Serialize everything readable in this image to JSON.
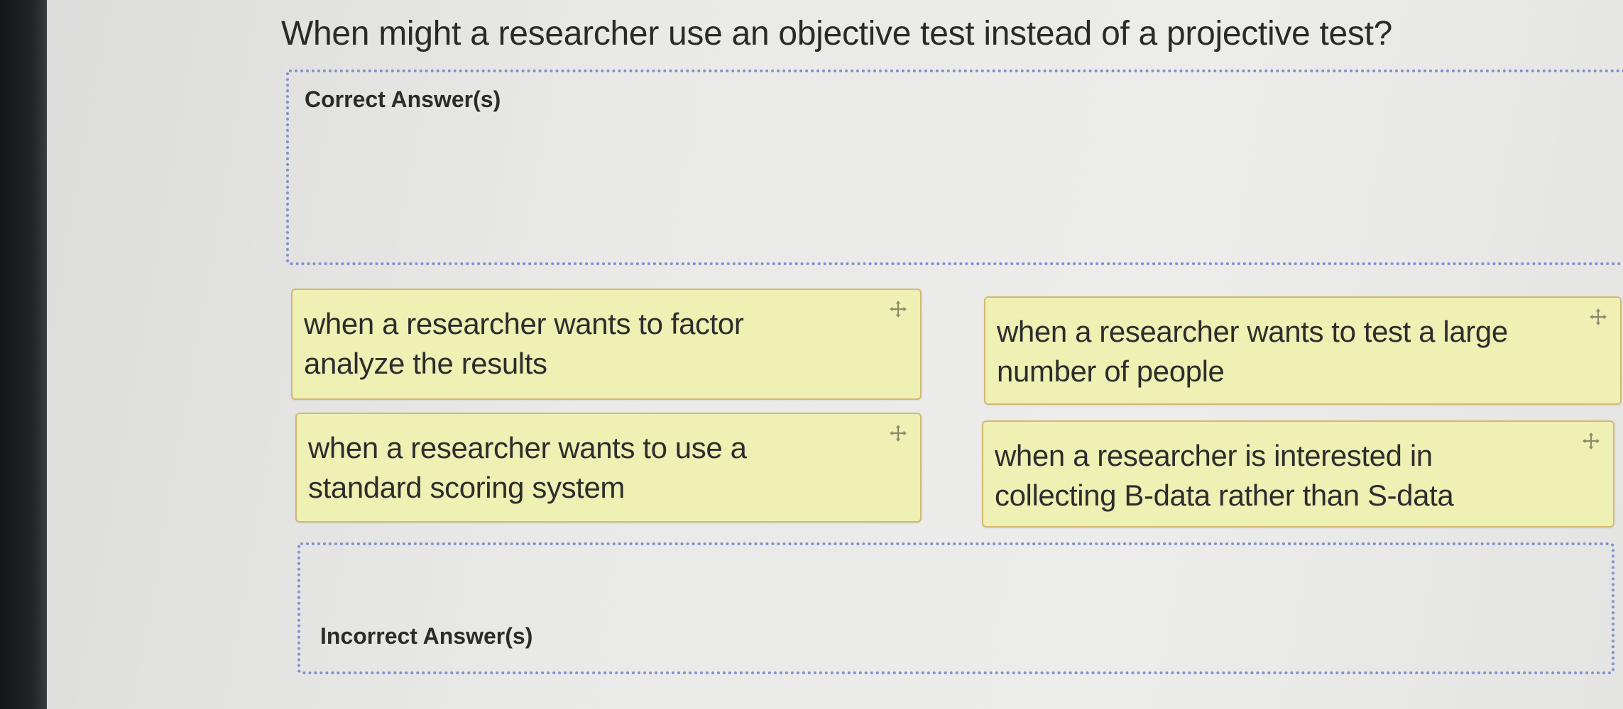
{
  "question": "When might a researcher use an objective test instead of a projective test?",
  "zones": {
    "correct_label": "Correct Answer(s)",
    "incorrect_label": "Incorrect Answer(s)"
  },
  "answers": [
    {
      "text": "when a researcher wants to factor analyze the results",
      "icon": "drag-move-icon"
    },
    {
      "text": "when a researcher wants to test a large number of people",
      "icon": "drag-move-icon"
    },
    {
      "text": "when a researcher wants to use a standard scoring system",
      "icon": "drag-move-icon"
    },
    {
      "text": "when a researcher is interested in collecting B-data rather than S-data",
      "icon": "drag-move-icon"
    }
  ],
  "colors": {
    "card_background": "#eef0b4",
    "card_border": "#d4b872",
    "dropzone_border": "#7f8fd0",
    "page_background": "#e9e9e7"
  }
}
